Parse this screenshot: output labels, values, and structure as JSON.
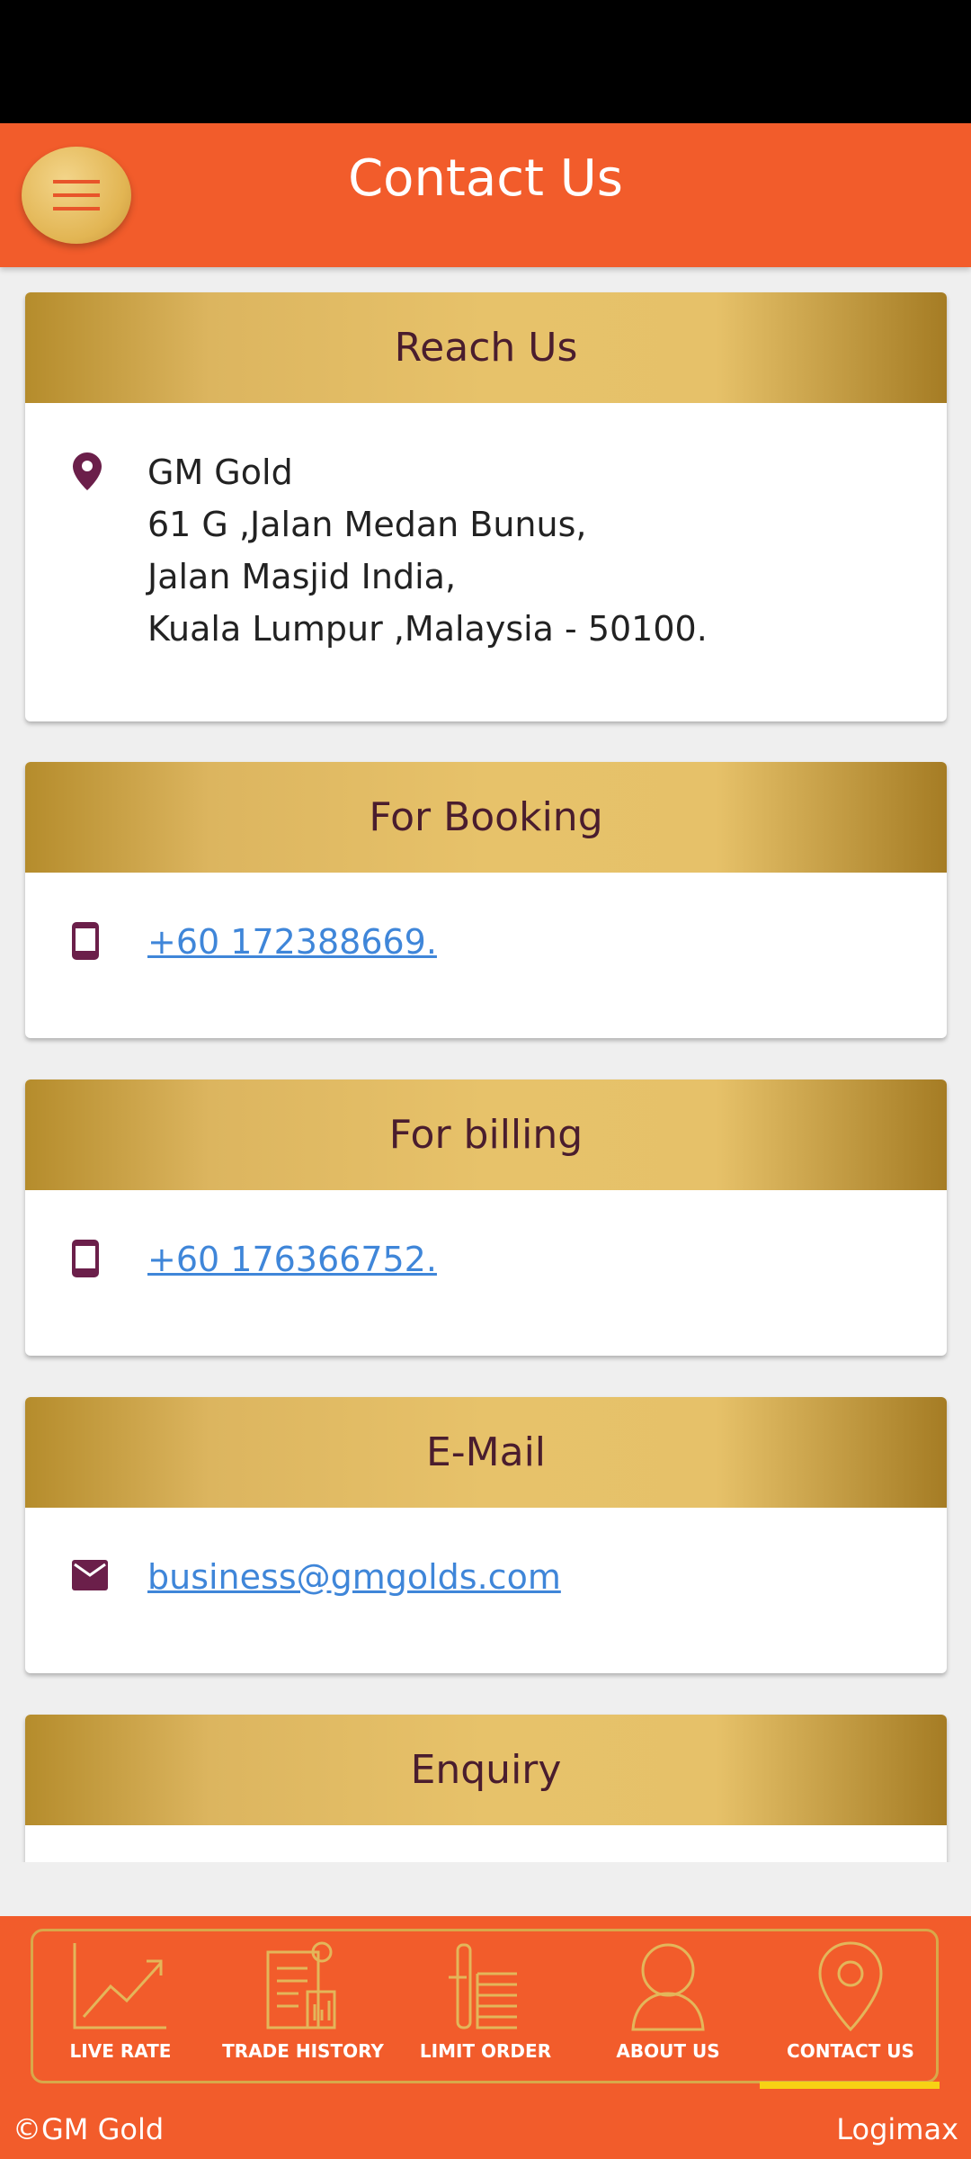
{
  "header": {
    "title": "Contact Us",
    "menu_icon": "hamburger-menu-icon"
  },
  "cards": {
    "reach": {
      "title": "Reach Us",
      "icon": "location-pin-icon",
      "address": "GM Gold\n61 G ,Jalan Medan Bunus,\nJalan Masjid India,\nKuala Lumpur ,Malaysia - 50100."
    },
    "booking": {
      "title": "For Booking",
      "icon": "mobile-phone-icon",
      "phone": "+60 172388669."
    },
    "billing": {
      "title": "For billing",
      "icon": "mobile-phone-icon",
      "phone": "+60 176366752."
    },
    "email": {
      "title": "E-Mail",
      "icon": "mail-icon",
      "address": "business@gmgolds.com"
    },
    "enquiry": {
      "title": "Enquiry"
    }
  },
  "bottom_nav": {
    "items": [
      {
        "label": "LIVE RATE",
        "icon": "chart-trend-icon"
      },
      {
        "label": "TRADE HISTORY",
        "icon": "receipt-icon"
      },
      {
        "label": "LIMIT ORDER",
        "icon": "order-list-icon"
      },
      {
        "label": "ABOUT US",
        "icon": "person-icon"
      },
      {
        "label": "CONTACT US",
        "icon": "location-pin-icon"
      }
    ],
    "active": "CONTACT US"
  },
  "footer": {
    "left": "©GM Gold",
    "right": "Logimax"
  },
  "colors": {
    "primary": "#f25c2b",
    "gold": "#e7c26a",
    "heading": "#4a1d2e",
    "link": "#3f86d9",
    "icon": "#6b1f4a"
  }
}
